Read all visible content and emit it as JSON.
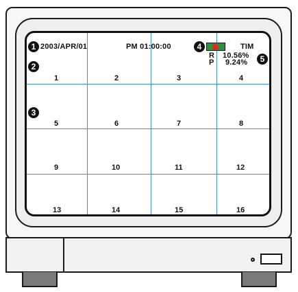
{
  "osd": {
    "date": "2003/APR/01",
    "time": "PM 01:00:00",
    "mode": "TIM",
    "r_label": "R",
    "r_value": "10.56%",
    "p_label": "P",
    "p_value": "9.24%"
  },
  "callouts": [
    "1",
    "2",
    "3",
    "4",
    "5"
  ],
  "channels": [
    "1",
    "2",
    "3",
    "4",
    "5",
    "6",
    "7",
    "8",
    "9",
    "10",
    "11",
    "12",
    "13",
    "14",
    "15",
    "16"
  ],
  "colors": {
    "grid_line": "#3a8fd6",
    "record_indicator_bg": "#2e8f3e",
    "record_indicator_dot": "#e0291b",
    "foot": "#7a7a7a"
  }
}
